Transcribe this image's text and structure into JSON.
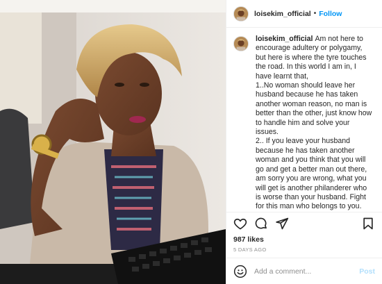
{
  "header": {
    "username": "loisekim_official",
    "separator": "•",
    "follow_label": "Follow"
  },
  "caption": {
    "username": "loisekim_official",
    "paragraphs": [
      "Am not here to encourage adultery or polygamy, but here is where the tyre touches the road. In this world I am in, I have learnt that,",
      "1..No woman should leave her husband because he has taken another woman reason, no man is better than the other, just know how to handle him and solve your issues.",
      "2.. If you leave your husband because he has taken another woman and you think that you will go and get a better man out there, am sorry you are wrong, what you will get is another philanderer who is worse than your husband. Fight for this man who belongs to you. Therefore, women, stick to your men, know how to handle them, solve your"
    ]
  },
  "actions": {
    "like_icon": "heart-icon",
    "comment_icon": "comment-icon",
    "share_icon": "paper-plane-icon",
    "save_icon": "bookmark-icon"
  },
  "likes": "987 likes",
  "timestamp": "5 DAYS AGO",
  "comment_box": {
    "emoji_icon": "smiley-icon",
    "placeholder": "Add a comment...",
    "post_label": "Post"
  },
  "colors": {
    "accent": "#0095f6",
    "post_disabled": "#b2dffc",
    "muted": "#8e8e8e",
    "border": "#efefef"
  }
}
